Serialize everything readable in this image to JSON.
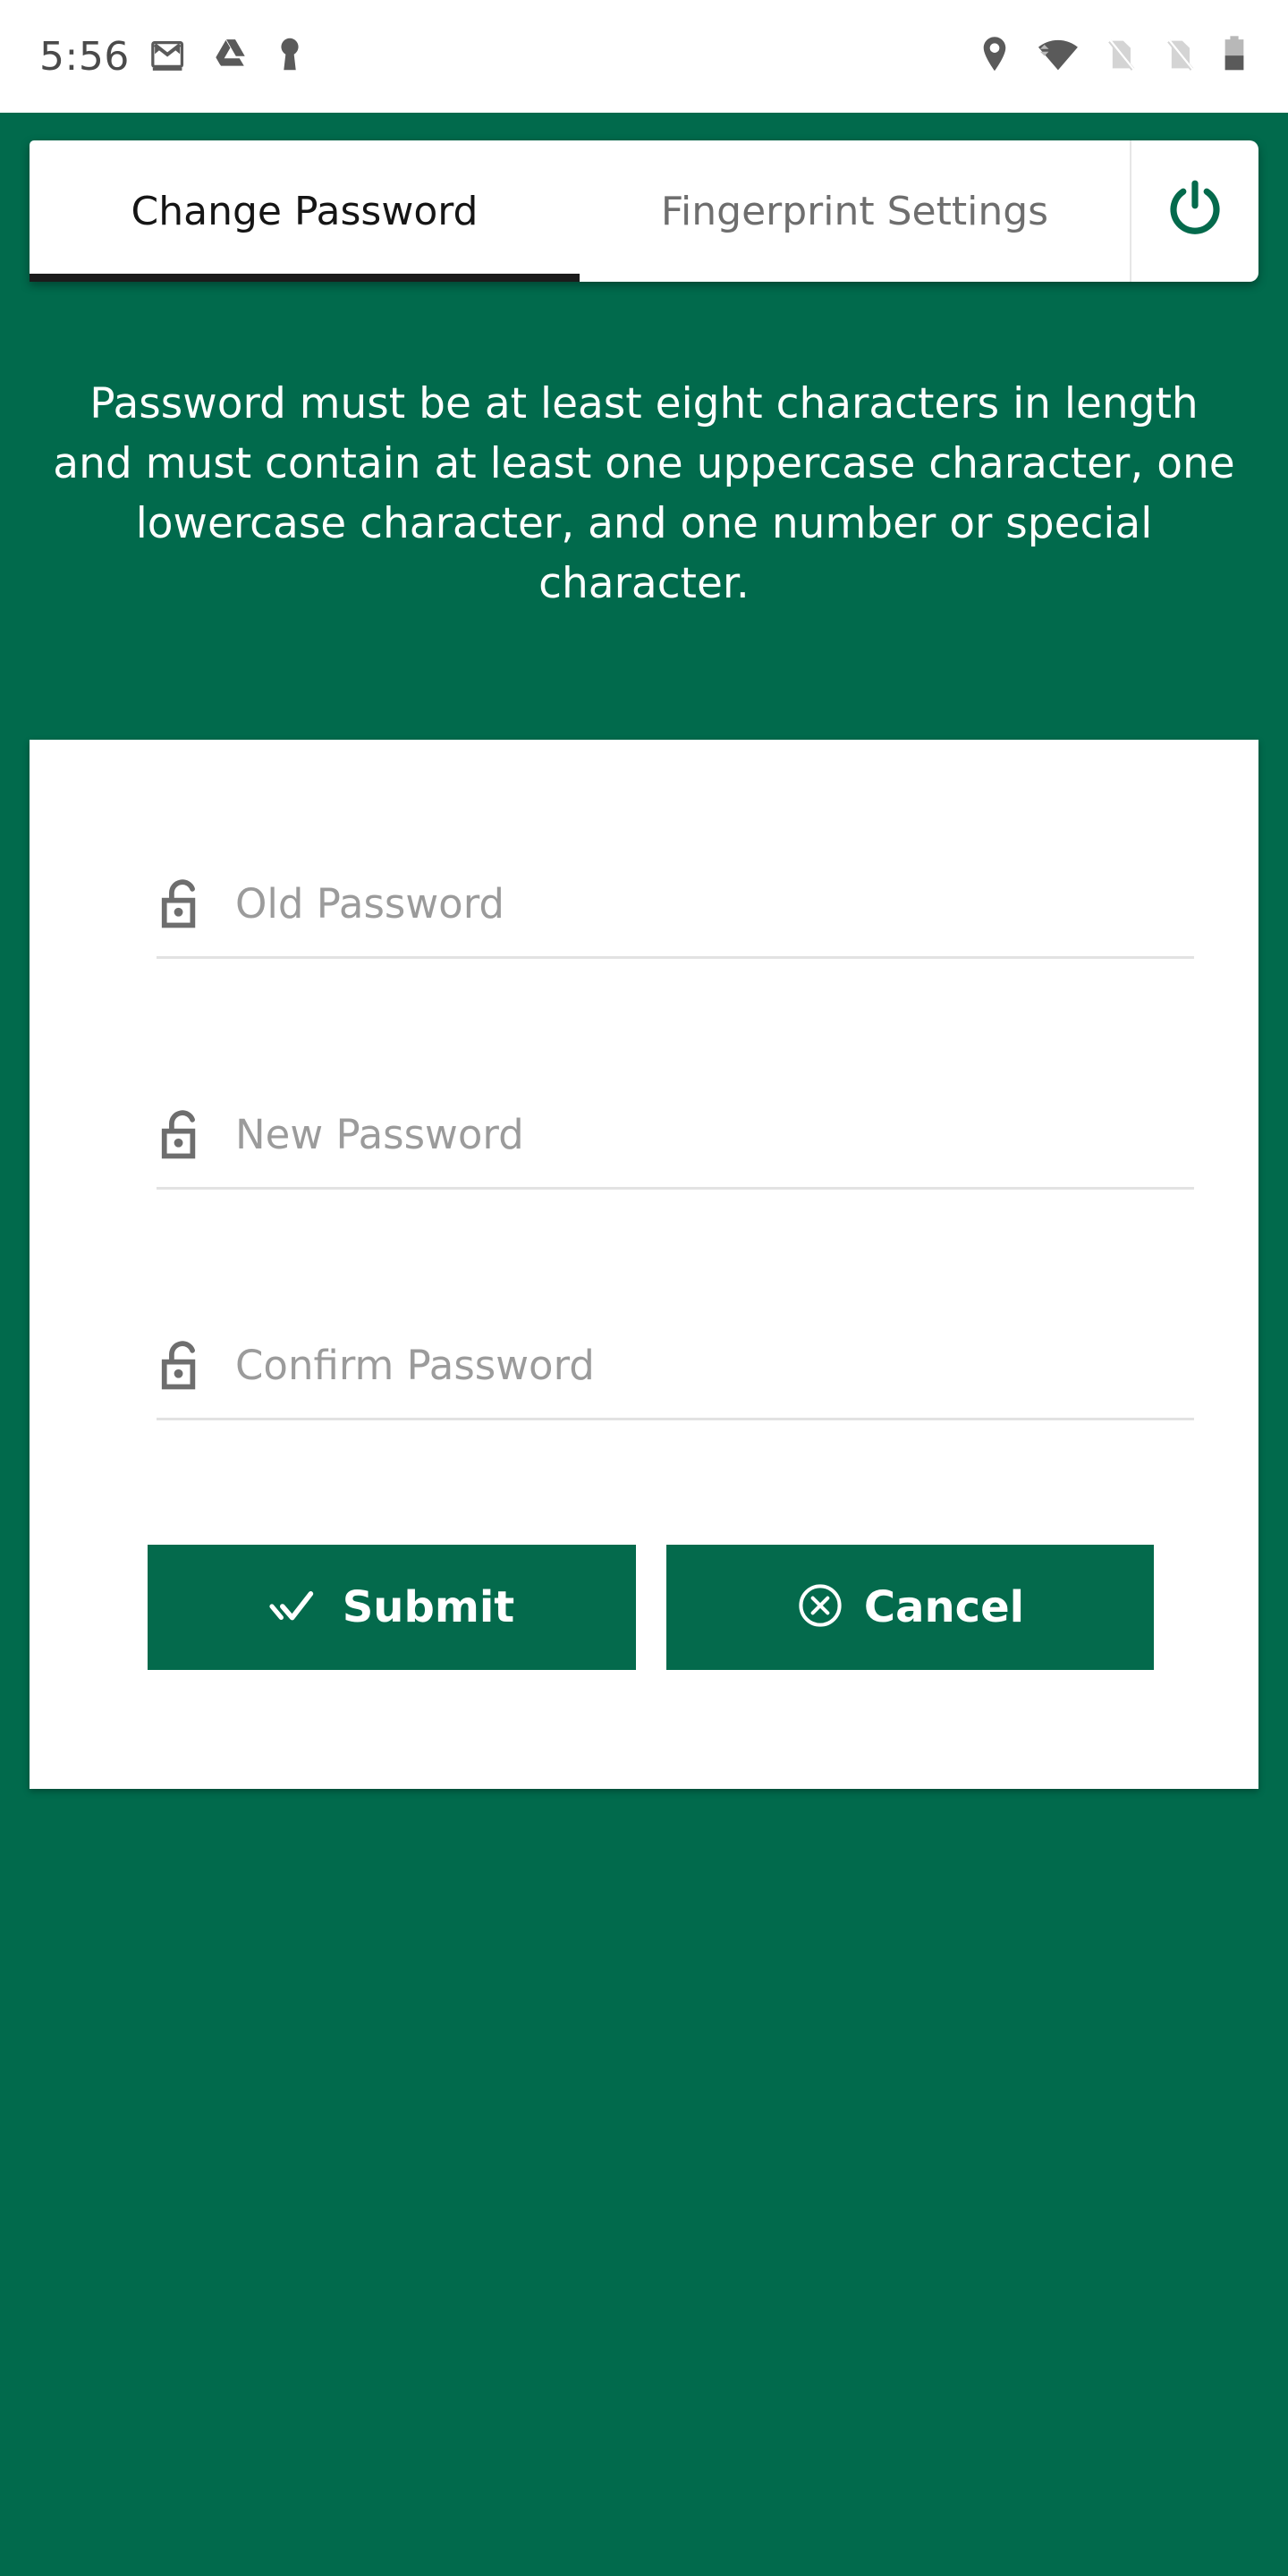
{
  "status_bar": {
    "time": "5:56",
    "left_icons": [
      "gmail-icon",
      "google-drive-icon",
      "keyhole-icon"
    ],
    "right_icons": [
      "location-pin-icon",
      "wifi-icon",
      "no-sim-1-icon",
      "no-sim-2-icon",
      "battery-icon"
    ],
    "battery_level_percent": 40
  },
  "tabs": [
    {
      "id": "change-password",
      "label": "Change Password",
      "active": true
    },
    {
      "id": "fingerprint-settings",
      "label": "Fingerprint Settings",
      "active": false
    }
  ],
  "power_button": {
    "icon": "power-icon",
    "label": ""
  },
  "instructions": {
    "text": "Password must be at least eight characters in length and must contain at least one uppercase character, one lowercase character, and one number or special character."
  },
  "form": {
    "fields": [
      {
        "id": "old-password",
        "placeholder": "Old Password",
        "value": "",
        "icon": "unlock-icon"
      },
      {
        "id": "new-password",
        "placeholder": "New Password",
        "value": "",
        "icon": "unlock-icon"
      },
      {
        "id": "confirm-password",
        "placeholder": "Confirm Password",
        "value": "",
        "icon": "unlock-icon"
      }
    ],
    "buttons": [
      {
        "id": "submit",
        "label": "Submit",
        "icon": "double-check-icon"
      },
      {
        "id": "cancel",
        "label": "Cancel",
        "icon": "circle-x-icon"
      }
    ]
  },
  "colors": {
    "background_green": "#016A4C",
    "button_green": "#046A4C",
    "active_tab_underline": "#1B1B1B",
    "placeholder_gray": "#9B9B9B",
    "field_line_gray": "#E2E2E2",
    "status_icon_gray": "#5A5A5A"
  }
}
